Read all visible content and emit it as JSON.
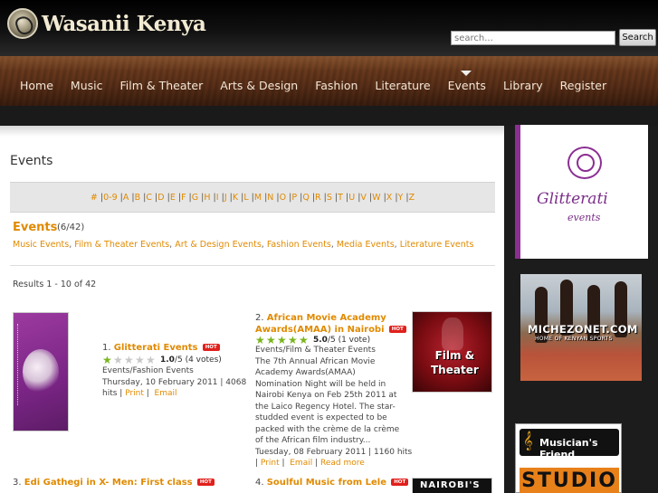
{
  "site": {
    "name": "Wasanii Kenya"
  },
  "search": {
    "placeholder": "search...",
    "button": "Search"
  },
  "nav": {
    "items": [
      "Home",
      "Music",
      "Film & Theater",
      "Arts & Design",
      "Fashion",
      "Literature",
      "Events",
      "Library",
      "Register"
    ],
    "active": "Events"
  },
  "content": {
    "title": "Events",
    "alphabet": [
      "#",
      "0-9",
      "A",
      "B",
      "C",
      "D",
      "E",
      "F",
      "G",
      "H",
      "I",
      "J",
      "K",
      "L",
      "M",
      "N",
      "O",
      "P",
      "Q",
      "R",
      "S",
      "T",
      "U",
      "V",
      "W",
      "X",
      "Y",
      "Z"
    ],
    "section": {
      "heading": "Events",
      "count": "(6/42)"
    },
    "categories": [
      "Music Events",
      "Film & Theater Events",
      "Art & Design Events",
      "Fashion Events",
      "Media Events",
      "Literature Events"
    ],
    "results": "Results 1 - 10 of 42",
    "hot_label": "HOT",
    "events": [
      {
        "num": "1.",
        "title": "Glitterati Events",
        "rating": "1.0",
        "rating_tail": "/5 (4 votes)",
        "stars": 1,
        "category": "Events/Fashion Events",
        "date": "Thursday, 10 February 2011 | 4068",
        "hits": "hits",
        "print": "Print",
        "email": "Email"
      },
      {
        "num": "2.",
        "title_line1": "African Movie Academy",
        "title_line2": "Awards(AMAA) in Nairobi",
        "rating": "5.0",
        "rating_tail": "/5 (1 vote)",
        "stars": 5,
        "category": "Events/Film & Theater Events",
        "desc": [
          "The 7th Annual African Movie",
          "Academy Awards(AMAA)",
          "Nomination Night will be held in",
          "Nairobi Kenya on Feb 25th 2011 at",
          "the Laico Regency Hotel. The star-",
          "studded event is expected to be",
          "packed with the crème de la crème",
          "of the African film industry..."
        ],
        "date": "Tuesday, 08 February 2011 | 1160 hits",
        "print": "Print",
        "email": "Email",
        "readmore": "Read more",
        "thumb_text": [
          "Film &",
          "Theater"
        ]
      },
      {
        "num": "3.",
        "title": "Edi Gathegi in X- Men: First class"
      },
      {
        "num": "4.",
        "title": "Soulful Music from Lele",
        "thumb_text": "NAIROBI'S"
      }
    ]
  },
  "ads": {
    "glitterati": {
      "name": "Glitterati",
      "sub": "events"
    },
    "michezo": {
      "name": "MICHEZONET.COM",
      "sub": "HOME OF KENYAN SPORTS"
    },
    "musician": {
      "name": "Musician's Friend",
      "sub": "STUDIO"
    }
  },
  "colors": {
    "accent": "#e08a00",
    "nav_bg": "#6a3a1d",
    "hot": "#e0201c",
    "star": "#7ab51d"
  }
}
